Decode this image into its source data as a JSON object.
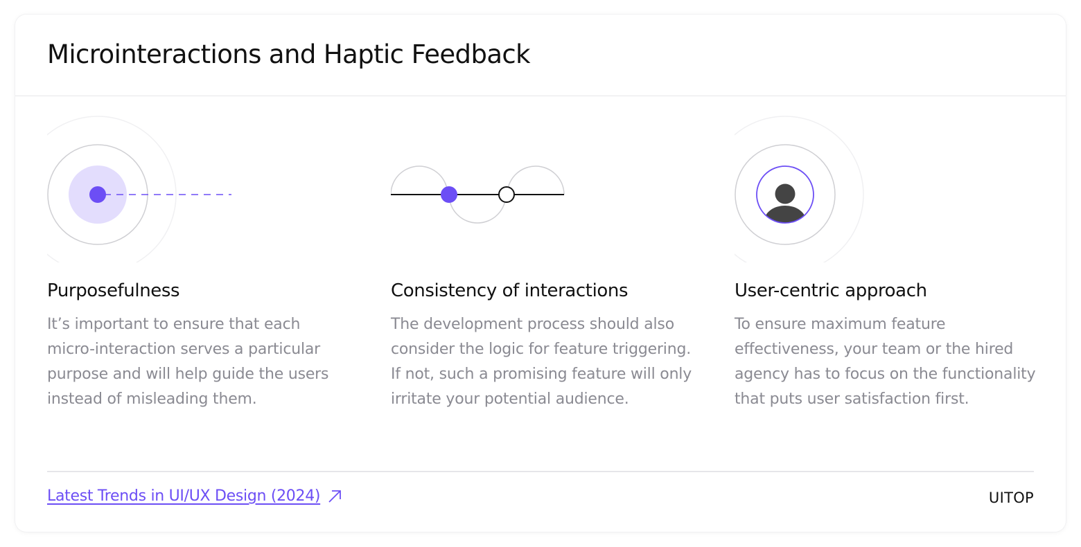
{
  "header": {
    "title": "Microinteractions and Haptic Feedback"
  },
  "features": [
    {
      "title": "Purposefulness",
      "description": "It’s important to ensure that each micro-interaction serves a particular purpose and will help guide the users instead of misleading them.",
      "icon": "target-pulse-icon"
    },
    {
      "title": "Consistency of interactions",
      "description": "The development process should also consider the logic for feature triggering. If not, such a promising feature will only irritate your potential audience.",
      "icon": "slider-wave-icon"
    },
    {
      "title": "User-centric approach",
      "description": "To ensure maximum feature effectiveness, your team or the hired agency has to focus on the functionality that puts user satisfaction first.",
      "icon": "user-avatar-icon"
    }
  ],
  "footer": {
    "link_label": "Latest Trends in UI/UX Design (2024)",
    "brand": "UITOP"
  },
  "colors": {
    "accent": "#6c4ef5",
    "accent_light": "#e3ddfd",
    "text": "#111111",
    "muted": "#8a8a92",
    "divider": "#e6e6e9"
  }
}
